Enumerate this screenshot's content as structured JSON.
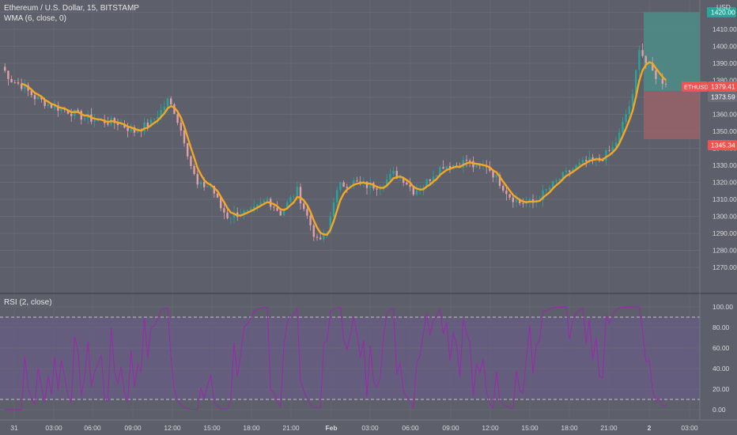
{
  "header": {
    "symbol_title": "Ethereum / U.S. Dollar, 15, BITSTAMP",
    "indicator_wma": "WMA (6, close, 0)",
    "indicator_rsi": "RSI (2, close)",
    "currency": "USD"
  },
  "colors": {
    "background": "#5d606b",
    "rsi_band": "#6a5b8c",
    "rsi_line": "#9c27b0",
    "wma_line": "#f5a623",
    "candle_up": "#26a69a",
    "candle_down": "#e0a0a8",
    "profit_zone": "#4e8a86",
    "loss_zone": "#95636a",
    "price_tag": "#ef5350",
    "target_tag": "#26a69a"
  },
  "price_axis": {
    "labels": [
      "1420.00",
      "1410.00",
      "1400.00",
      "1390.00",
      "1380.00",
      "1370.00",
      "1360.00",
      "1350.00",
      "1340.00",
      "1330.00",
      "1320.00",
      "1310.00",
      "1300.00",
      "1290.00",
      "1280.00",
      "1270.00"
    ],
    "top_tag": "1420.00",
    "current_symbol": "ETHUSD",
    "current_price": "1379.41",
    "entry_price": "1373.59",
    "stop_price": "1345.34"
  },
  "rsi_axis": {
    "labels": [
      "100.00",
      "80.00",
      "60.00",
      "40.00",
      "20.00",
      "0.00"
    ],
    "upper_level": 90,
    "lower_level": 10
  },
  "time_axis": {
    "labels": [
      "31",
      "03:00",
      "06:00",
      "09:00",
      "12:00",
      "15:00",
      "18:00",
      "21:00",
      "Feb",
      "03:00",
      "06:00",
      "09:00",
      "12:00",
      "15:00",
      "18:00",
      "21:00",
      "2",
      "03:00"
    ]
  },
  "chart_data": {
    "type": "candlestick",
    "title": "Ethereum / U.S. Dollar, 15, BITSTAMP",
    "x_range": [
      "31",
      "2 03:00"
    ],
    "ylim": [
      1264,
      1428
    ],
    "price_anchors": [
      [
        0,
        1388
      ],
      [
        3,
        1380
      ],
      [
        6,
        1377
      ],
      [
        10,
        1370
      ],
      [
        15,
        1365
      ],
      [
        20,
        1362
      ],
      [
        25,
        1358
      ],
      [
        30,
        1356
      ],
      [
        35,
        1355
      ],
      [
        40,
        1350
      ],
      [
        45,
        1355
      ],
      [
        48,
        1362
      ],
      [
        50,
        1368
      ],
      [
        52,
        1362
      ],
      [
        55,
        1345
      ],
      [
        57,
        1330
      ],
      [
        59,
        1318
      ],
      [
        63,
        1318
      ],
      [
        66,
        1305
      ],
      [
        68,
        1300
      ],
      [
        72,
        1302
      ],
      [
        75,
        1302
      ],
      [
        80,
        1310
      ],
      [
        84,
        1302
      ],
      [
        87,
        1310
      ],
      [
        89,
        1315
      ],
      [
        92,
        1300
      ],
      [
        95,
        1285
      ],
      [
        98,
        1290
      ],
      [
        100,
        1310
      ],
      [
        102,
        1318
      ],
      [
        106,
        1320
      ],
      [
        110,
        1318
      ],
      [
        114,
        1318
      ],
      [
        118,
        1325
      ],
      [
        121,
        1322
      ],
      [
        124,
        1315
      ],
      [
        127,
        1318
      ],
      [
        130,
        1325
      ],
      [
        133,
        1330
      ],
      [
        137,
        1330
      ],
      [
        140,
        1333
      ],
      [
        143,
        1328
      ],
      [
        146,
        1330
      ],
      [
        150,
        1320
      ],
      [
        153,
        1312
      ],
      [
        156,
        1308
      ],
      [
        160,
        1308
      ],
      [
        164,
        1315
      ],
      [
        168,
        1322
      ],
      [
        172,
        1328
      ],
      [
        176,
        1332
      ],
      [
        180,
        1333
      ],
      [
        184,
        1340
      ],
      [
        186,
        1348
      ],
      [
        188,
        1360
      ],
      [
        190,
        1370
      ],
      [
        192,
        1400
      ],
      [
        194,
        1390
      ],
      [
        196,
        1385
      ],
      [
        198,
        1380
      ],
      [
        200,
        1379
      ]
    ],
    "wma_series": "WMA (6, close, 0)",
    "rsi_series": "RSI (2, close)",
    "rsi_ylim": [
      0,
      100
    ],
    "rsi_levels": [
      10,
      90
    ],
    "position": {
      "target": 1420.0,
      "entry": 1373.59,
      "stop": 1345.34,
      "current": 1379.41
    }
  }
}
